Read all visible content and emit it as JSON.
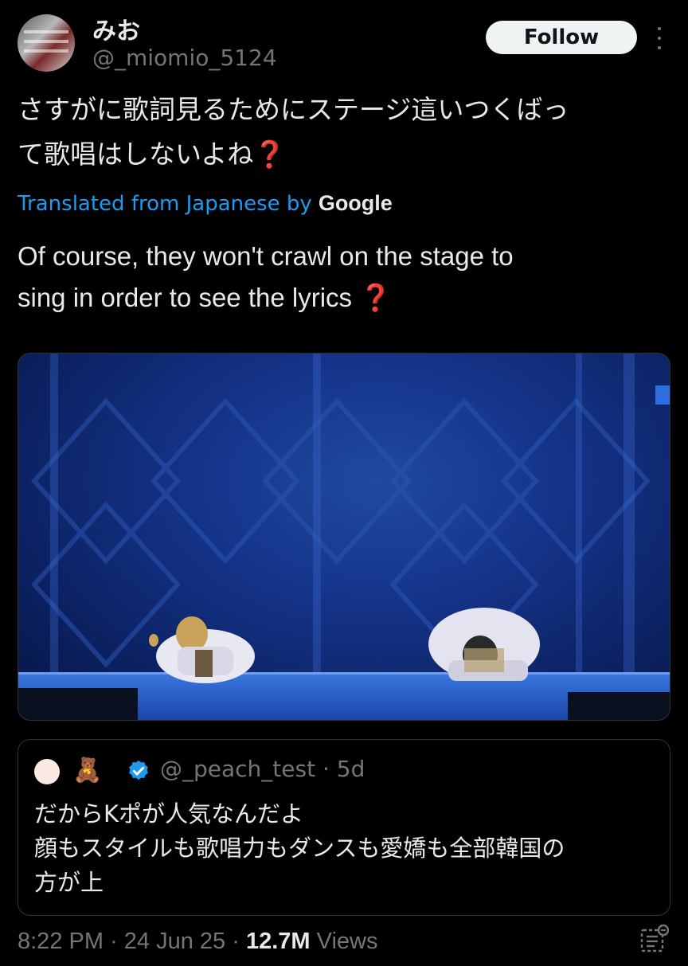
{
  "author": {
    "display_name": "みお",
    "handle": "@_miomio_5124",
    "avatar_icon": "profile-photo"
  },
  "follow_label": "Follow",
  "more_icon": "more-vertical-icon",
  "tweet": {
    "text_line1": "さすがに歌詞見るためにステージ這いつくばっ",
    "text_line2": "て歌唱はしないよね",
    "question_mark": "❓",
    "translated_prefix": "Translated from Japanese by",
    "translated_brand": "Google",
    "translation_line1": "Of course, they won't crawl on the stage to",
    "translation_line2": "sing in order to see the lyrics"
  },
  "media": {
    "type": "photo",
    "description_icon": "stage-photo",
    "colors": {
      "stage_blue": "#15348a",
      "floor_blue": "#2a62c8"
    }
  },
  "quote": {
    "avatar_emoji": "🧸",
    "verified_icon": "verified-badge-icon",
    "handle": "@_peach_test",
    "separator": "·",
    "age": "5d",
    "text_line1": "だからKポが人気なんだよ",
    "text_line2": "顔もスタイルも歌唱力もダンスも愛嬌も全部韓国の",
    "text_line3": "方が上"
  },
  "footer": {
    "time": "8:22 PM",
    "sep1": "·",
    "date": "24 Jun 25",
    "sep2": "·",
    "views_count": "12.7M",
    "views_label": "Views",
    "analytics_icon": "analytics-icon"
  },
  "colors": {
    "background": "#000000",
    "text": "#e7e9ea",
    "muted": "#71767b",
    "link": "#1d9bf0",
    "verified": "#1d9bf0"
  }
}
